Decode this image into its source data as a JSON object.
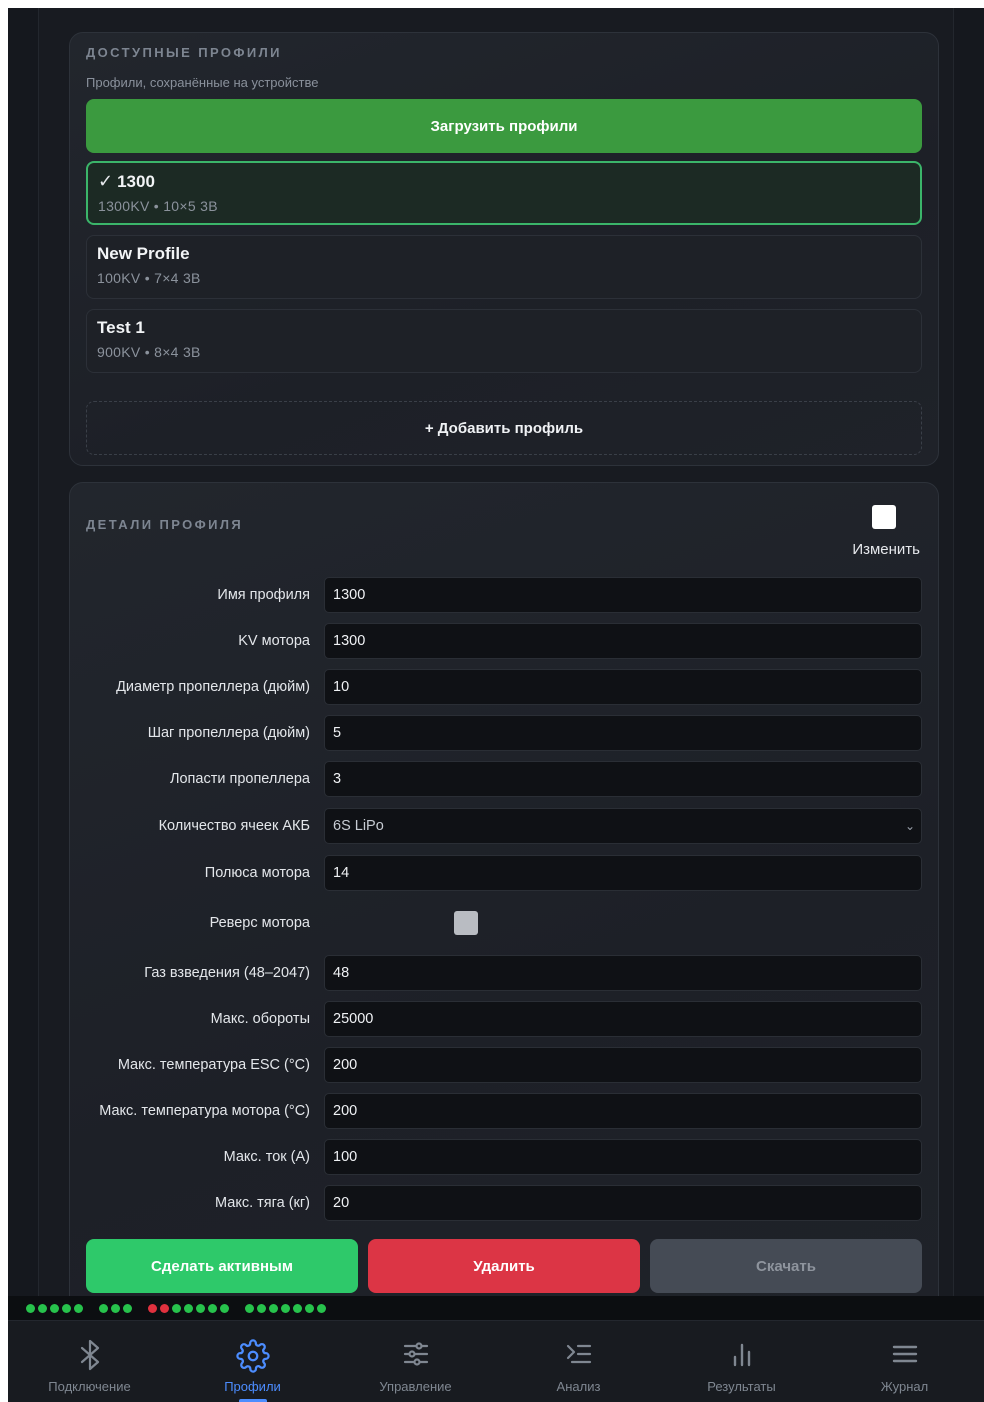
{
  "profiles_card": {
    "title": "Доступные профили",
    "subtitle": "Профили, сохранённые на устройстве",
    "load_button": "Загрузить профили",
    "items": [
      {
        "name": "1300",
        "meta": "1300KV  •  10×5 3В",
        "active": true
      },
      {
        "name": "New Profile",
        "meta": "100KV  •  7×4 3В",
        "active": false
      },
      {
        "name": "Test 1",
        "meta": "900KV  •  8×4 3В",
        "active": false
      }
    ],
    "add_button": "+ Добавить профиль"
  },
  "details_card": {
    "title": "Детали профиля",
    "edit_label": "Изменить",
    "fields": [
      {
        "label": "Имя профиля",
        "value": "1300"
      },
      {
        "label": "KV мотора",
        "value": "1300"
      },
      {
        "label": "Диаметр пропеллера (дюйм)",
        "value": "10"
      },
      {
        "label": "Шаг пропеллера (дюйм)",
        "value": "5"
      },
      {
        "label": "Лопасти пропеллера",
        "value": "3"
      },
      {
        "label": "Количество ячеек АКБ",
        "value": "6S LiPo"
      },
      {
        "label": "Полюса мотора",
        "value": "14"
      },
      {
        "label": "Реверс мотора",
        "value": ""
      },
      {
        "label": "Газ взведения (48–2047)",
        "value": "48"
      },
      {
        "label": "Макс. обороты",
        "value": "25000"
      },
      {
        "label": "Макс. температура ESC (°C)",
        "value": "200"
      },
      {
        "label": "Макс. температура мотора (°C)",
        "value": "200"
      },
      {
        "label": "Макс. ток (A)",
        "value": "100"
      },
      {
        "label": "Макс. тяга (кг)",
        "value": "20"
      }
    ],
    "buttons": {
      "activate": "Сделать активным",
      "delete": "Удалить",
      "download": "Скачать"
    }
  },
  "status_dots": {
    "colors": {
      "green": "#27c24c",
      "red": "#e0313e"
    },
    "groups": [
      [
        "green",
        "green",
        "green",
        "green",
        "green"
      ],
      [
        "green",
        "green",
        "green"
      ],
      [
        "red",
        "red",
        "green",
        "green",
        "green",
        "green",
        "green"
      ],
      [
        "green",
        "green",
        "green",
        "green",
        "green",
        "green",
        "green"
      ]
    ]
  },
  "nav": {
    "items": [
      {
        "label": "Подключение",
        "icon": "bluetooth-icon",
        "active": false
      },
      {
        "label": "Профили",
        "icon": "gear-icon",
        "active": true
      },
      {
        "label": "Управление",
        "icon": "sliders-icon",
        "active": false
      },
      {
        "label": "Анализ",
        "icon": "list-indent-icon",
        "active": false
      },
      {
        "label": "Результаты",
        "icon": "bar-chart-icon",
        "active": false
      },
      {
        "label": "Журнал",
        "icon": "menu-icon",
        "active": false
      }
    ],
    "colors": {
      "active": "#4c8dff",
      "inactive": "#7f8791"
    }
  }
}
